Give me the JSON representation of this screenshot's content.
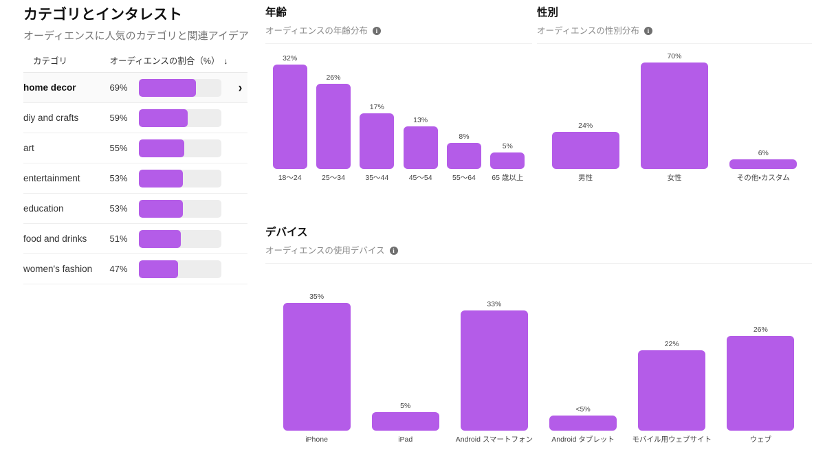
{
  "categories_panel": {
    "title": "カテゴリとインタレスト",
    "subtitle": "オーディエンスに人気のカテゴリと関連アイデア",
    "columns": {
      "category": "カテゴリ",
      "share": "オーディエンスの割合（%）",
      "sort_icon": "down-arrow-icon",
      "sort_glyph": "↓"
    },
    "rows": [
      {
        "name": "home decor",
        "pct_label": "69%",
        "pct": 69
      },
      {
        "name": "diy and crafts",
        "pct_label": "59%",
        "pct": 59
      },
      {
        "name": "art",
        "pct_label": "55%",
        "pct": 55
      },
      {
        "name": "entertainment",
        "pct_label": "53%",
        "pct": 53
      },
      {
        "name": "education",
        "pct_label": "53%",
        "pct": 53
      },
      {
        "name": "food and drinks",
        "pct_label": "51%",
        "pct": 51
      },
      {
        "name": "women's fashion",
        "pct_label": "47%",
        "pct": 47
      }
    ],
    "chevron_glyph": "›"
  },
  "sections": {
    "age": {
      "title": "年齢",
      "subtitle": "オーディエンスの年齢分布",
      "info_glyph": "i"
    },
    "gender": {
      "title": "性別",
      "subtitle": "オーディエンスの性別分布",
      "info_glyph": "i"
    },
    "device": {
      "title": "デバイス",
      "subtitle": "オーディエンスの使用デバイス",
      "info_glyph": "i"
    }
  },
  "colors": {
    "bar_purple": "#b45ce8",
    "track_gray": "#ededed",
    "text_dark": "#111111",
    "text_muted": "#767676"
  },
  "chart_data": [
    {
      "type": "bar",
      "name": "age",
      "title": "年齢",
      "subtitle": "オーディエンスの年齢分布",
      "xlabel": "",
      "ylabel": "",
      "ylim": [
        0,
        32
      ],
      "grid": false,
      "legend": "none",
      "categories": [
        "18〜24",
        "25〜34",
        "35〜44",
        "45〜54",
        "55〜64",
        "65 歳以上"
      ],
      "values": [
        32,
        26,
        17,
        13,
        8,
        5
      ],
      "value_labels": [
        "32%",
        "26%",
        "17%",
        "13%",
        "8%",
        "5%"
      ]
    },
    {
      "type": "bar",
      "name": "gender",
      "title": "性別",
      "subtitle": "オーディエンスの性別分布",
      "xlabel": "",
      "ylabel": "",
      "ylim": [
        0,
        70
      ],
      "grid": false,
      "legend": "none",
      "categories": [
        "男性",
        "女性",
        "その他・カスタム"
      ],
      "values": [
        24,
        70,
        6
      ],
      "value_labels": [
        "24%",
        "70%",
        "6%"
      ]
    },
    {
      "type": "bar",
      "name": "device",
      "title": "デバイス",
      "subtitle": "オーディエンスの使用デバイス",
      "xlabel": "",
      "ylabel": "",
      "ylim": [
        0,
        35
      ],
      "grid": false,
      "legend": "none",
      "categories": [
        "iPhone",
        "iPad",
        "Android スマートフォン",
        "Android タブレット",
        "モバイル用ウェブサイト",
        "ウェブ"
      ],
      "values": [
        35,
        5,
        33,
        4,
        22,
        26
      ],
      "value_labels": [
        "35%",
        "5%",
        "33%",
        "<5%",
        "22%",
        "26%"
      ]
    },
    {
      "type": "bar",
      "name": "categories_and_interests",
      "title": "カテゴリとインタレスト",
      "subtitle": "オーディエンスに人気のカテゴリと関連アイデア",
      "xlabel": "オーディエンスの割合（%）",
      "ylabel": "カテゴリ",
      "ylim": [
        0,
        100
      ],
      "grid": false,
      "legend": "none",
      "orientation": "horizontal",
      "categories": [
        "home decor",
        "diy and crafts",
        "art",
        "entertainment",
        "education",
        "food and drinks",
        "women's fashion"
      ],
      "values": [
        69,
        59,
        55,
        53,
        53,
        51,
        47
      ],
      "value_labels": [
        "69%",
        "59%",
        "55%",
        "53%",
        "53%",
        "51%",
        "47%"
      ]
    }
  ]
}
